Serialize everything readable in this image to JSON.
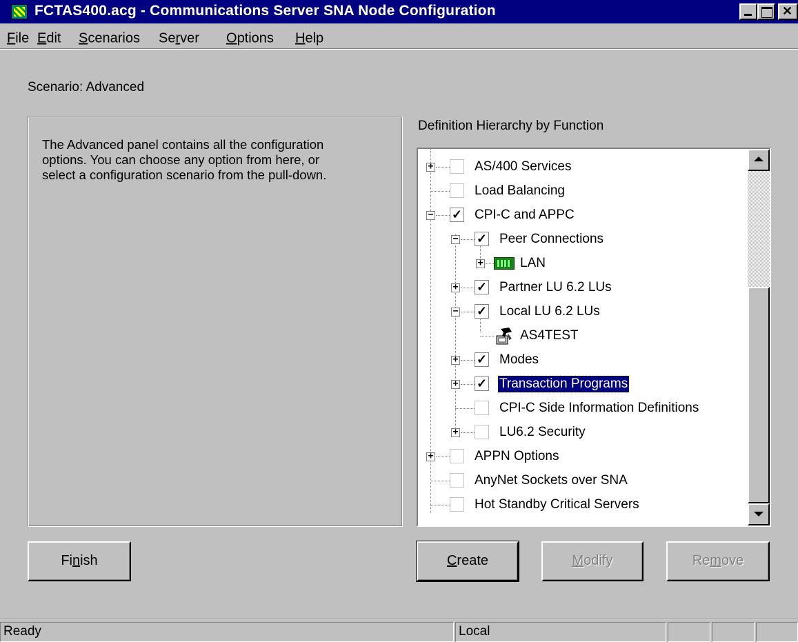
{
  "window": {
    "title": "FCTAS400.acg - Communications Server SNA Node Configuration"
  },
  "menu": {
    "items": [
      {
        "label": "File",
        "mnemonic": "F",
        "rest": "ile"
      },
      {
        "label": "Edit",
        "mnemonic": "E",
        "rest": "dit"
      },
      {
        "label": "Scenarios",
        "mnemonic": "S",
        "rest": "cenarios"
      },
      {
        "label": "Server",
        "pre": "Se",
        "mnemonic": "r",
        "rest": "ver"
      },
      {
        "label": "Options",
        "mnemonic": "O",
        "rest": "ptions"
      },
      {
        "label": "Help",
        "mnemonic": "H",
        "rest": "elp"
      }
    ]
  },
  "scenario_label": "Scenario: Advanced",
  "description": {
    "line1": "The Advanced panel contains all the configuration",
    "line2": "options. You can choose any option from here, or",
    "line3": "select a configuration scenario from the pull-down."
  },
  "tree": {
    "caption": "Definition Hierarchy by Function",
    "items": [
      {
        "label": "AS/400 Services",
        "checked": false,
        "expander": "+"
      },
      {
        "label": "Load Balancing",
        "checked": false,
        "expander": ""
      },
      {
        "label": "CPI-C and APPC",
        "checked": true,
        "expander": "-"
      },
      {
        "label": "Peer Connections",
        "checked": true,
        "expander": "-"
      },
      {
        "label": "LAN",
        "icon": "lan-adapter-icon",
        "expander": "+"
      },
      {
        "label": "Partner LU 6.2 LUs",
        "checked": true,
        "expander": "+"
      },
      {
        "label": "Local LU 6.2 LUs",
        "checked": true,
        "expander": "-"
      },
      {
        "label": "AS4TEST",
        "icon": "local-lu-icon",
        "expander": ""
      },
      {
        "label": "Modes",
        "checked": true,
        "expander": "+"
      },
      {
        "label": "Transaction Programs",
        "checked": true,
        "expander": "+",
        "selected": true
      },
      {
        "label": "CPI-C Side Information Definitions",
        "checked": false,
        "expander": ""
      },
      {
        "label": "LU6.2 Security",
        "checked": false,
        "expander": "+"
      },
      {
        "label": "APPN Options",
        "checked": false,
        "expander": "+"
      },
      {
        "label": "AnyNet Sockets over SNA",
        "checked": false,
        "expander": ""
      },
      {
        "label": "Hot Standby Critical Servers",
        "checked": false,
        "expander": ""
      }
    ]
  },
  "buttons": {
    "finish": {
      "pre": "Fi",
      "mnemonic": "n",
      "rest": "ish"
    },
    "create": {
      "pre": "",
      "mnemonic": "C",
      "rest": "reate"
    },
    "modify": {
      "pre": "",
      "mnemonic": "M",
      "rest": "odify"
    },
    "remove": {
      "pre": "Re",
      "mnemonic": "m",
      "rest": "ove"
    }
  },
  "status": {
    "message": "Ready",
    "location": "Local"
  },
  "colors": {
    "titlebar": "#000080",
    "face": "#c0c0c0",
    "selection": "#000080"
  }
}
